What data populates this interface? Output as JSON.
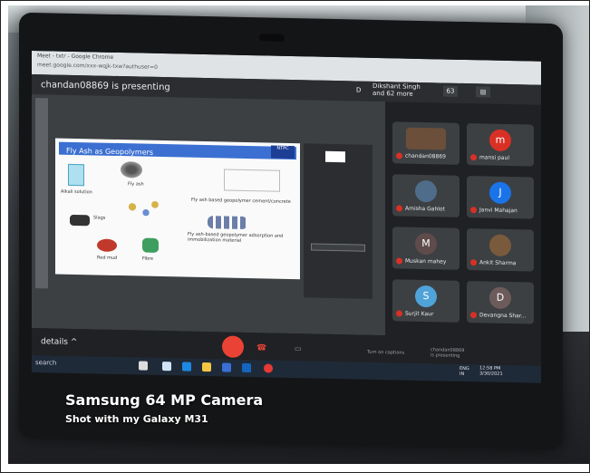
{
  "browser": {
    "tab_title": "Meet - txtr - Google Chrome",
    "url": "meet.google.com/xxx-wqjk-txw?authuser=0"
  },
  "meet": {
    "presenting_banner": "chandan08869 is presenting",
    "self_initial": "D",
    "others": "Dikshant Singh and 62 more",
    "participant_count": "63",
    "details_label": "details ^",
    "turn_on_captions": "Turn on captions",
    "presenting_status": [
      "chandan08869",
      "is presenting"
    ],
    "participants": [
      {
        "name": "chandan08869",
        "initial": "",
        "color": "#6b4f3a"
      },
      {
        "name": "mansi paul",
        "initial": "m",
        "color": "#d93025"
      },
      {
        "name": "Amisha Gahlot",
        "initial": "",
        "color": "#4f6d8a"
      },
      {
        "name": "Janvi Mahajan",
        "initial": "J",
        "color": "#1a73e8"
      },
      {
        "name": "Muskan mahey",
        "initial": "M",
        "color": "#5f4b4b"
      },
      {
        "name": "Ankit Sharma",
        "initial": "",
        "color": "#7a5a3c"
      },
      {
        "name": "Surjit Kaur",
        "initial": "S",
        "color": "#4fa3d8"
      },
      {
        "name": "Devangna Shar...",
        "initial": "D",
        "color": "#6d5b5b"
      }
    ]
  },
  "slide": {
    "title": "Fly Ash as Geopolymers",
    "logo": "NTPC",
    "labels": {
      "fly_ash": "Fly ash",
      "alkali": "Alkali solution",
      "slags": "Slags",
      "red_mud": "Red mud",
      "fibre": "Fibre",
      "cement": "Fly ash based geopolymer cement/concrete",
      "adsorption": "Fly ash-based geopolymer adsorption and immobilization material"
    }
  },
  "taskbar": {
    "search_text": "search",
    "lang": [
      "ENG",
      "IN"
    ],
    "time": "12:58 PM",
    "date": "3/30/2021"
  },
  "watermark": {
    "line1": "Samsung 64 MP Camera",
    "line2": "Shot with my Galaxy M31"
  }
}
